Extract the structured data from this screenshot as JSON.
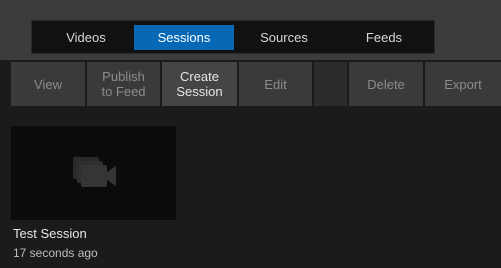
{
  "tabs": [
    {
      "label": "Videos",
      "active": false
    },
    {
      "label": "Sessions",
      "active": true
    },
    {
      "label": "Sources",
      "active": false
    },
    {
      "label": "Feeds",
      "active": false
    }
  ],
  "toolbar": {
    "view": "View",
    "publish_line1": "Publish",
    "publish_line2": "to Feed",
    "create_line1": "Create",
    "create_line2": "Session",
    "edit": "Edit",
    "delete": "Delete",
    "export": "Export"
  },
  "session": {
    "title": "Test Session",
    "age": "17 seconds ago",
    "icon": "video-camera-icon"
  },
  "colors": {
    "accent": "#0769b6",
    "background": "#1b1b1b"
  }
}
